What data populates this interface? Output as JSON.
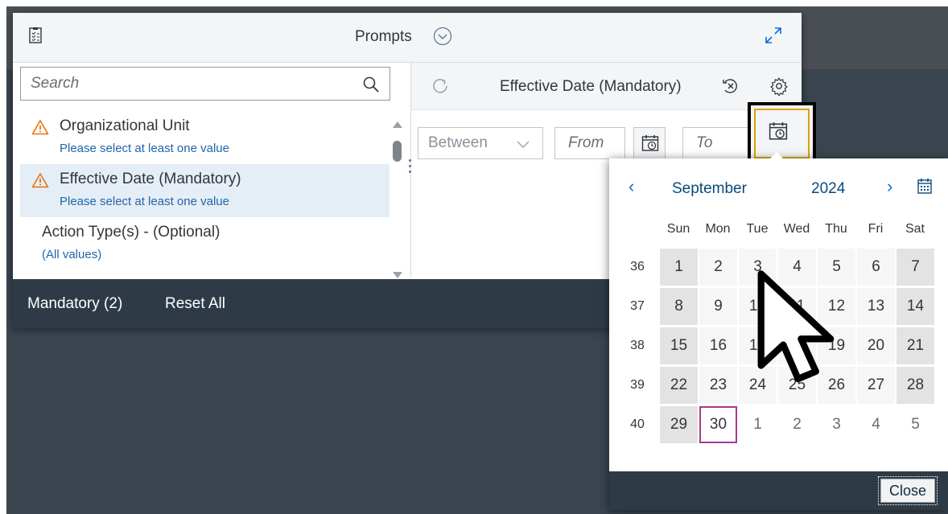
{
  "dialog": {
    "title": "Prompts",
    "footer": {
      "mandatory_label": "Mandatory (2)",
      "reset_label": "Reset All"
    }
  },
  "search": {
    "placeholder": "Search",
    "value": ""
  },
  "prompt_list": [
    {
      "title": "Organizational Unit",
      "subtitle": "Please select at least one value",
      "warning": true,
      "selected": false
    },
    {
      "title": "Effective Date (Mandatory)",
      "subtitle": "Please select at least one value",
      "warning": true,
      "selected": true
    },
    {
      "title": "Action Type(s) - (Optional)",
      "subtitle": "(All values)",
      "warning": false,
      "selected": false
    }
  ],
  "detail": {
    "title": "Effective Date (Mandatory)",
    "operator": "Between",
    "from_placeholder": "From",
    "to_placeholder": "To"
  },
  "calendar": {
    "month": "September",
    "year": "2024",
    "weekdays": [
      "Sun",
      "Mon",
      "Tue",
      "Wed",
      "Thu",
      "Fri",
      "Sat"
    ],
    "weeks": [
      {
        "num": "36",
        "days": [
          "1",
          "2",
          "3",
          "4",
          "5",
          "6",
          "7"
        ]
      },
      {
        "num": "37",
        "days": [
          "8",
          "9",
          "10",
          "11",
          "12",
          "13",
          "14"
        ]
      },
      {
        "num": "38",
        "days": [
          "15",
          "16",
          "17",
          "18",
          "19",
          "20",
          "21"
        ]
      },
      {
        "num": "39",
        "days": [
          "22",
          "23",
          "24",
          "25",
          "26",
          "27",
          "28"
        ]
      },
      {
        "num": "40",
        "days": [
          "29",
          "30",
          "1",
          "2",
          "3",
          "4",
          "5"
        ]
      }
    ],
    "today": "30",
    "close_label": "Close"
  },
  "colors": {
    "accent": "#0a6ed1",
    "warning": "#e9730c",
    "today_border": "#a7388e",
    "footer_bg": "#2e3b47",
    "focus_ring": "#d9a400"
  },
  "icons": {
    "header_left": "clipboard-checklist-icon",
    "title_chevron": "chevron-down-circle-icon",
    "expand": "expand-icon",
    "search": "search-icon",
    "warning": "warning-triangle-icon",
    "refresh": "refresh-icon",
    "clear": "clear-filter-icon",
    "settings": "gear-icon",
    "calendar": "calendar-clock-icon"
  }
}
